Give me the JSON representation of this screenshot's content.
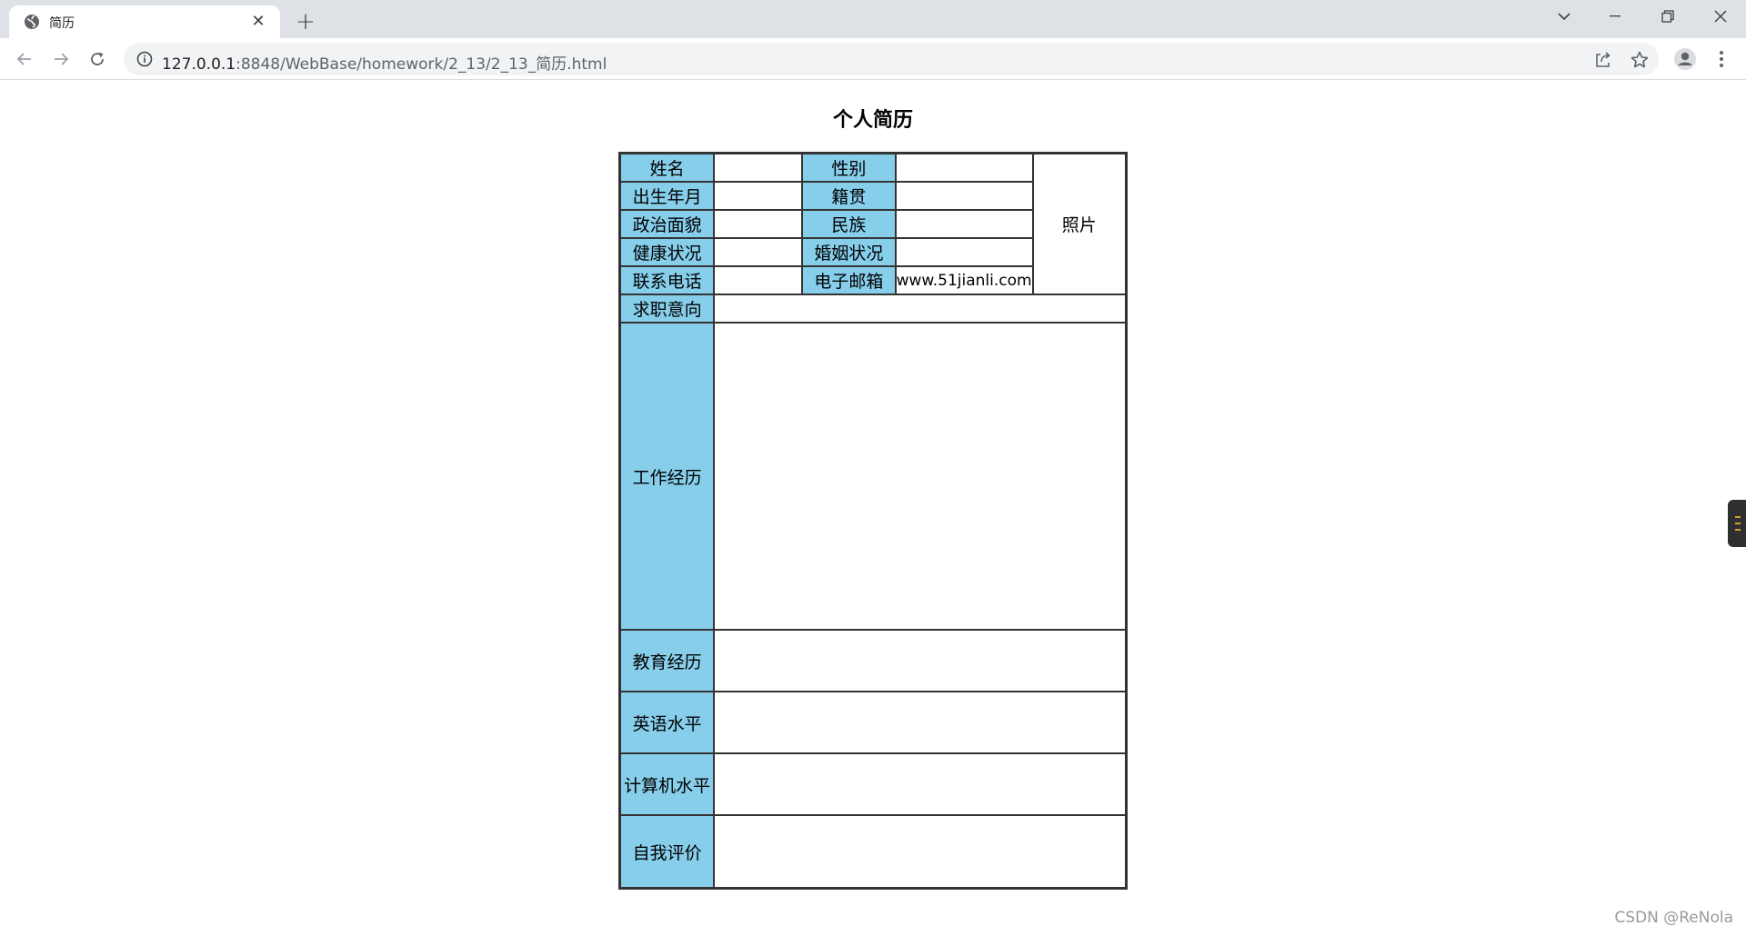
{
  "browser": {
    "tab_title": "简历",
    "url_host": "127.0.0.1",
    "url_path": ":8848/WebBase/homework/2_13/2_13_简历.html"
  },
  "page": {
    "title": "个人简历",
    "watermark": "CSDN @ReNola"
  },
  "resume": {
    "name_label": "姓名",
    "gender_label": "性别",
    "birth_label": "出生年月",
    "native_label": "籍贯",
    "political_label": "政治面貌",
    "ethnic_label": "民族",
    "health_label": "健康状况",
    "marital_label": "婚姻状况",
    "phone_label": "联系电话",
    "email_label": "电子邮箱",
    "email_value": "www.51jianli.com",
    "photo_label": "照片",
    "intent_label": "求职意向",
    "work_label": "工作经历",
    "edu_label": "教育经历",
    "english_label": "英语水平",
    "computer_label": "计算机水平",
    "self_label": "自我评价"
  },
  "colors": {
    "label_bg": "#87ceeb",
    "border": "#333333"
  }
}
